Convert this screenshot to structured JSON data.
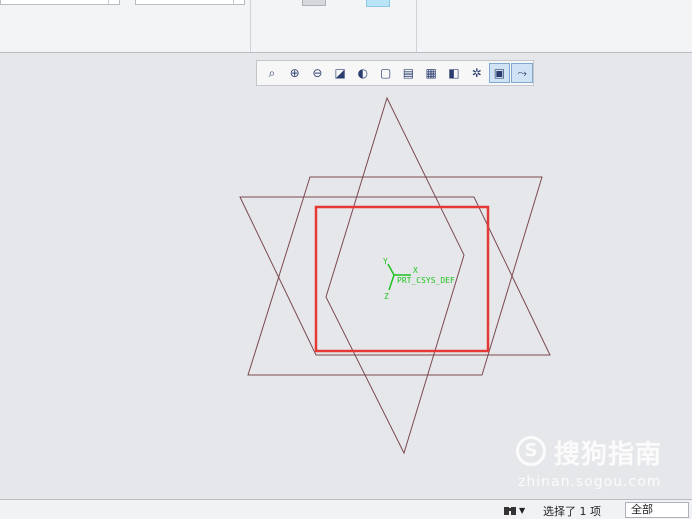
{
  "toolbar": {
    "buttons": [
      {
        "name": "refit-icon",
        "glyph": "⌕"
      },
      {
        "name": "zoom-in-icon",
        "glyph": "⊕"
      },
      {
        "name": "zoom-out-icon",
        "glyph": "⊖"
      },
      {
        "name": "repaint-icon",
        "glyph": "◪"
      },
      {
        "name": "display-style-icon",
        "glyph": "◐"
      },
      {
        "name": "saved-orientations-icon",
        "glyph": "▢"
      },
      {
        "name": "view-manager-icon",
        "glyph": "▤"
      },
      {
        "name": "perspective-icon",
        "glyph": "▦"
      },
      {
        "name": "section-icon",
        "glyph": "◧"
      },
      {
        "name": "datum-display-icon",
        "glyph": "✲"
      },
      {
        "name": "annotation-display-icon",
        "glyph": "▣"
      },
      {
        "name": "spin-center-icon",
        "glyph": "⤳"
      }
    ]
  },
  "csys": {
    "label": "PRT_CSYS_DEF",
    "axis_x": "X",
    "axis_y": "Y",
    "axis_z": "Z",
    "color": "#1fc21f"
  },
  "statusbar": {
    "selection_text": "选择了 1 项",
    "filter_value": "全部"
  },
  "watermark": {
    "cn": "搜狗指南",
    "url": "zhinan.sogou.com"
  },
  "colors": {
    "sketch_lines": "#7a4a50",
    "highlight": "#e53935",
    "background": "#e6e7ea"
  }
}
